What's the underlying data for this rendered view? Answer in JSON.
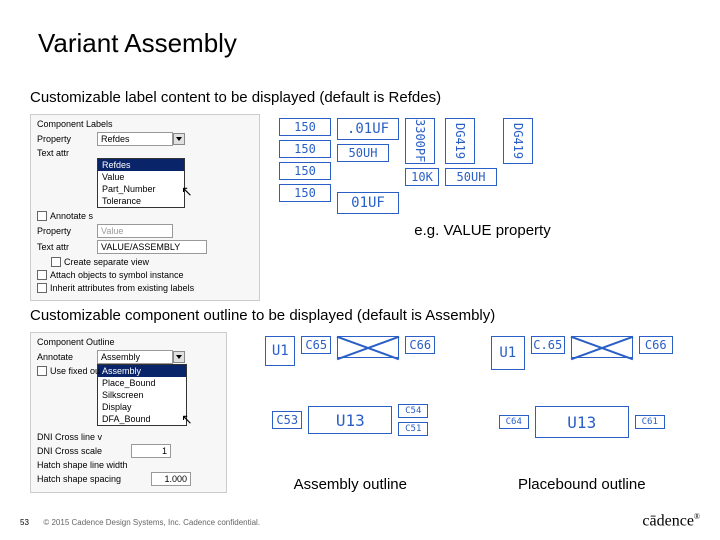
{
  "title": "Variant Assembly",
  "section1": {
    "desc": "Customizable label content to be displayed (default is Refdes)",
    "panel": {
      "title": "Component Labels",
      "prop1_label": "Property",
      "prop1_value": "Refdes",
      "text1_label": "Text attr",
      "dropdown": [
        "Refdes",
        "Value",
        "Part_Number",
        "Tolerance"
      ],
      "annotate_label": "Annotate s",
      "prop2_label": "Property",
      "prop2_value": "Value",
      "text2_label": "Text attr",
      "text2_value": "VALUE/ASSEMBLY",
      "create_view_label": "Create separate view",
      "attach_label": "Attach objects to symbol instance",
      "inherit_label": "Inherit attributes from existing labels"
    },
    "components": {
      "c1": "150",
      "c2": ".01UF",
      "c3": "3300PF",
      "c4": "DG419",
      "c5": "150",
      "c6": "50UH",
      "c7": "10K",
      "c8": "50UH",
      "c9": "150",
      "c10": "150",
      "c11": "01UF",
      "c12": "DG419"
    },
    "caption": "e.g. VALUE property"
  },
  "section2": {
    "desc": "Customizable component outline to be displayed (default is Assembly)",
    "panel": {
      "title": "Component Outline",
      "annotate_label": "Annotate",
      "annotate_value": "Assembly",
      "dropdown": [
        "Assembly",
        "Place_Bound",
        "Silkscreen",
        "Display",
        "DFA_Bound"
      ],
      "fixed_label": "Use fixed ou",
      "dni_line_label": "DNI Cross line v",
      "dni_scale_label": "DNI Cross scale",
      "dni_scale_value": "1",
      "hatch_w_label": "Hatch shape line width",
      "hatch_s_label": "Hatch shape spacing",
      "hatch_s_value": "1.000"
    },
    "group_a": {
      "u1": "U1",
      "c65": "C65",
      "c66": "C66",
      "c53": "C53",
      "u13": "U13",
      "c51": "C51",
      "c54": "C54",
      "caption": "Assembly outline"
    },
    "group_b": {
      "u1": "U1",
      "c65": "C.65",
      "c66": "C66",
      "c64": "C64",
      "u13": "U13",
      "c61": "C61",
      "caption": "Placebound outline"
    }
  },
  "footer": {
    "page": "53",
    "copyright": "© 2015 Cadence Design Systems, Inc. Cadence confidential.",
    "logo": "cādence",
    "reg": "®"
  }
}
